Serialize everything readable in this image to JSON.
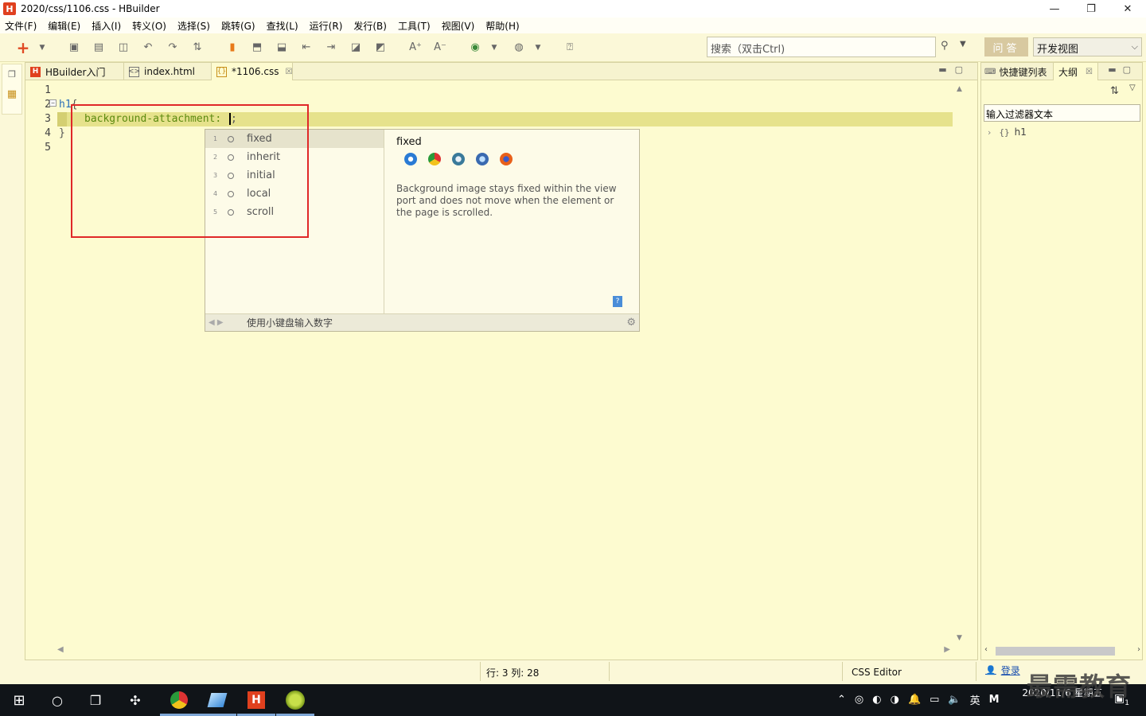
{
  "window": {
    "title": "2020/css/1106.css  -  HBuilder",
    "logo": "H",
    "controls": [
      "—",
      "❐",
      "✕"
    ]
  },
  "menu": [
    "文件(F)",
    "编辑(E)",
    "插入(I)",
    "转义(O)",
    "选择(S)",
    "跳转(G)",
    "查找(L)",
    "运行(R)",
    "发行(B)",
    "工具(T)",
    "视图(V)",
    "帮助(H)"
  ],
  "toolbar": {
    "search_placeholder": "搜索（双击Ctrl)",
    "qa_label": "问答",
    "view_label": "开发视图"
  },
  "editor": {
    "tabs": [
      {
        "label": "HBuilder入门",
        "icon": "H"
      },
      {
        "label": "index.html",
        "icon": "<>"
      },
      {
        "label": "*1106.css",
        "icon": "{}"
      }
    ],
    "line_numbers": [
      "1",
      "2",
      "3",
      "4",
      "5"
    ],
    "code": {
      "line2_selector": "h1",
      "line2_brace": "{",
      "line3_property": "background-attachment:",
      "line3_semicolon": ";",
      "line4_brace": "}"
    }
  },
  "autocomplete": {
    "items": [
      {
        "num": "1",
        "label": "fixed"
      },
      {
        "num": "2",
        "label": "inherit"
      },
      {
        "num": "3",
        "label": "initial"
      },
      {
        "num": "4",
        "label": "local"
      },
      {
        "num": "5",
        "label": "scroll"
      }
    ],
    "doc_title": "fixed",
    "doc_text": "Background image stays fixed within the viewport and does not move when the element or the page is scrolled.",
    "footer_hint": "使用小键盘输入数字"
  },
  "right_panel": {
    "tabs": [
      "快捷键列表",
      "大纲"
    ],
    "filter_text": "输入过滤器文本",
    "tree_item": "h1"
  },
  "status": {
    "position": "行: 3 列: 28",
    "editor_type": "CSS Editor",
    "login": "登录"
  },
  "taskbar": {
    "time": "",
    "date": "2020/11/6 星期五",
    "ime": "英",
    "notif_count": "1"
  },
  "watermark": "最需教育",
  "colors": {
    "editor_bg": "#fdfbd0",
    "highlight": "#e6e28c",
    "annotation": "#e02828",
    "accent": "#e0401e"
  }
}
